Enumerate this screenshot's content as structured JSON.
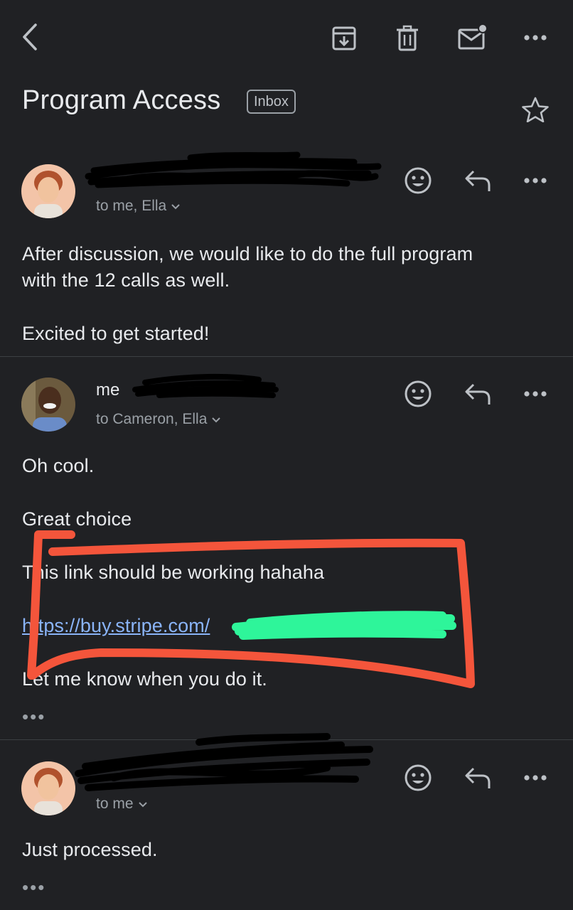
{
  "header": {
    "subject": "Program Access",
    "label": "Inbox"
  },
  "icons": {
    "back": "back-arrow-icon",
    "archive": "archive-icon",
    "delete": "trash-icon",
    "mark_unread": "mail-unread-icon",
    "more": "more-horizontal-icon",
    "star": "star-outline-icon",
    "emoji": "emoji-react-icon",
    "reply": "reply-icon",
    "expand": "chevron-down-icon"
  },
  "messages": [
    {
      "sender": "",
      "recipients": "to me, Ella",
      "body": [
        "After discussion, we would like to do the full program",
        "with the 12 calls as well.",
        "",
        "Excited to get started!"
      ]
    },
    {
      "sender": "me",
      "recipients": "to Cameron, Ella",
      "body": [
        "Oh cool.",
        "Great choice",
        "This link should be working hahaha",
        "https://buy.stripe.com/",
        "Let me know when you do it."
      ],
      "more": "•••"
    },
    {
      "sender": "",
      "recipients": "to me",
      "body": [
        "Just processed."
      ],
      "more": "•••"
    }
  ],
  "colors": {
    "background": "#202124",
    "text": "#e8eaed",
    "secondary_text": "#9aa0a6",
    "link": "#8ab4f8",
    "annotation_red": "#f4553b",
    "annotation_green": "#2ef59a",
    "redaction_black": "#000000"
  }
}
